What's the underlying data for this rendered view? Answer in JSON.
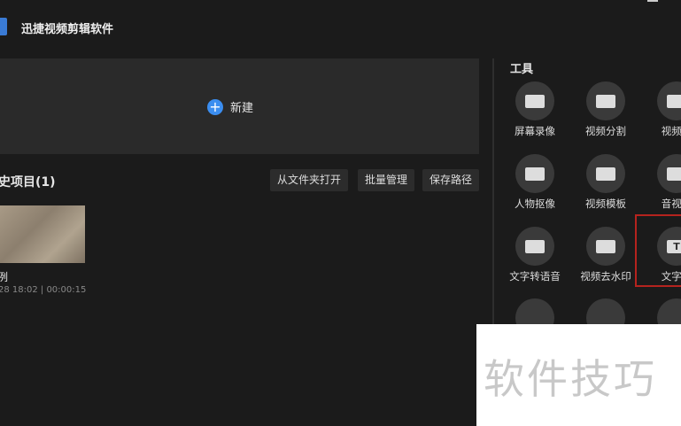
{
  "app": {
    "title": "迅捷视频剪辑软件"
  },
  "main": {
    "new_label": "新建",
    "history_title": "史项目(1)",
    "buttons": [
      "从文件夹打开",
      "批量管理",
      "保存路径"
    ],
    "project": {
      "name": "例",
      "meta": "28 18:02 | 00:00:15"
    }
  },
  "tools": {
    "title": "工具",
    "items": [
      {
        "label": "屏幕录像",
        "icon": "screen-record-icon"
      },
      {
        "label": "视频分割",
        "icon": "video-split-icon"
      },
      {
        "label": "视频合",
        "icon": "video-merge-icon"
      },
      {
        "label": "人物抠像",
        "icon": "person-cutout-icon"
      },
      {
        "label": "视频模板",
        "icon": "video-template-icon"
      },
      {
        "label": "音视频",
        "icon": "audio-video-icon"
      },
      {
        "label": "文字转语音",
        "icon": "text-to-speech-icon"
      },
      {
        "label": "视频去水印",
        "icon": "remove-watermark-icon"
      },
      {
        "label": "文字转",
        "icon": "text-convert-icon"
      }
    ]
  },
  "watermark": "软件技巧"
}
